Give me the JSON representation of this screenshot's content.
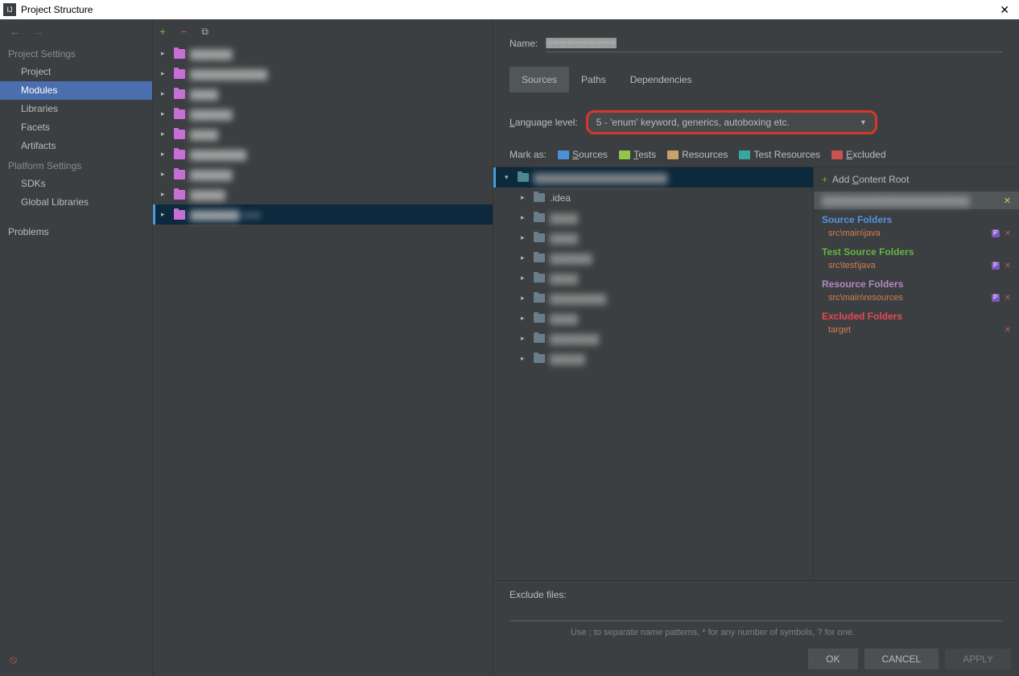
{
  "window": {
    "title": "Project Structure"
  },
  "sidebar": {
    "headings": {
      "project": "Project Settings",
      "platform": "Platform Settings"
    },
    "project_items": [
      "Project",
      "Modules",
      "Libraries",
      "Facets",
      "Artifacts"
    ],
    "platform_items": [
      "SDKs",
      "Global Libraries"
    ],
    "problems": "Problems",
    "selected": "Modules"
  },
  "modules": {
    "items": [
      {
        "label": "▓▓▓▓▓▓",
        "obscured": true
      },
      {
        "label": "▓▓▓▓▓▓▓▓▓▓▓",
        "obscured": true
      },
      {
        "label": "▓▓▓▓",
        "obscured": true
      },
      {
        "label": "▓▓▓▓▓▓",
        "obscured": true
      },
      {
        "label": "▓▓▓▓",
        "obscured": true
      },
      {
        "label": "▓▓▓▓▓▓▓▓",
        "obscured": true
      },
      {
        "label": "▓▓▓▓▓▓",
        "obscured": true
      },
      {
        "label": "▓▓▓▓▓",
        "obscured": true
      },
      {
        "label": "▓▓▓▓▓▓▓ core",
        "obscured": true,
        "selected": true
      }
    ]
  },
  "detail": {
    "name_label": "Name:",
    "name_value": "▓▓▓▓▓▓▓▓▓▓",
    "tabs": [
      "Sources",
      "Paths",
      "Dependencies"
    ],
    "active_tab": "Sources",
    "lang_label": "Language level:",
    "lang_value": "5 - 'enum' keyword, generics, autoboxing etc.",
    "mark_label": "Mark as:",
    "mark_buttons": {
      "sources": "Sources",
      "tests": "Tests",
      "resources": "Resources",
      "test_resources": "Test Resources",
      "excluded": "Excluded"
    },
    "tree": {
      "root": "▓▓▓▓▓▓▓▓▓▓▓▓▓▓▓▓▓▓▓",
      "children": [
        ".idea",
        "▓▓▓▓",
        "▓▓▓▓",
        "▓▓▓▓▓▓",
        "▓▓▓▓",
        "▓▓▓▓▓▓▓▓",
        "▓▓▓▓",
        "▓▓▓▓▓▓▓",
        "▓▓▓▓▓"
      ]
    },
    "roots": {
      "add_label": "Add Content Root",
      "path": "▓▓▓▓▓▓▓▓▓▓▓▓▓▓▓▓▓▓▓▓▓",
      "groups": [
        {
          "title": "Source Folders",
          "class": "fg-src",
          "items": [
            {
              "path": "src\\main\\java",
              "editable": true
            }
          ]
        },
        {
          "title": "Test Source Folders",
          "class": "fg-test",
          "items": [
            {
              "path": "src\\test\\java",
              "editable": true
            }
          ]
        },
        {
          "title": "Resource Folders",
          "class": "fg-res",
          "items": [
            {
              "path": "src\\main\\resources",
              "editable": true
            }
          ]
        },
        {
          "title": "Excluded Folders",
          "class": "fg-excl",
          "items": [
            {
              "path": "target",
              "editable": false
            }
          ]
        }
      ]
    },
    "exclude": {
      "label": "Exclude files:",
      "hint": "Use ; to separate name patterns, * for any number of symbols, ? for one."
    }
  },
  "buttons": {
    "ok": "OK",
    "cancel": "CANCEL",
    "apply": "APPLY"
  }
}
